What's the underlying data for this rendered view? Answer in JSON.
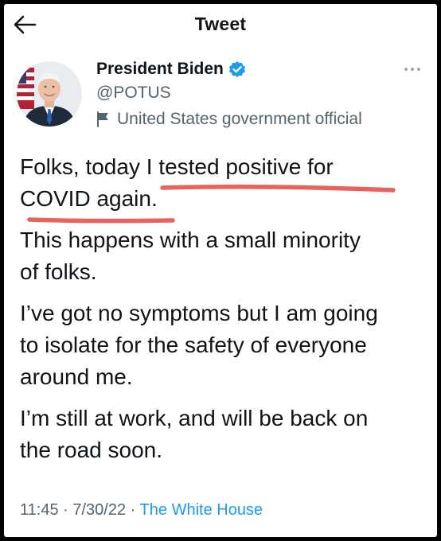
{
  "header": {
    "title": "Tweet",
    "back_icon": "back-arrow-icon"
  },
  "author": {
    "name": "President Biden",
    "handle": "@POTUS",
    "label": "United States government official",
    "verified_icon": "verified-badge-icon",
    "label_icon": "flag-icon",
    "avatar": "profile-photo"
  },
  "tweet": {
    "paragraphs": {
      "p1_line1": "Folks, today I tested positive for",
      "p1_line2": "COVID again.",
      "p2_line1": "This happens with a small minority",
      "p2_line2": "of folks.",
      "p3_line1": "I’ve got no symptoms but I am going",
      "p3_line2": "to isolate for the safety of everyone",
      "p3_line3": "around me.",
      "p4_line1": "I’m still at work, and will be back on",
      "p4_line2": "the road soon."
    },
    "annotation": {
      "type": "red-underline",
      "color": "#e8554e"
    }
  },
  "meta": {
    "time": "11:45",
    "separator": "·",
    "date": "7/30/22",
    "source": "The White House"
  },
  "colors": {
    "text": "#0f1419",
    "secondary": "#536471",
    "accent": "#1d9bf0",
    "frame": "#000000"
  }
}
